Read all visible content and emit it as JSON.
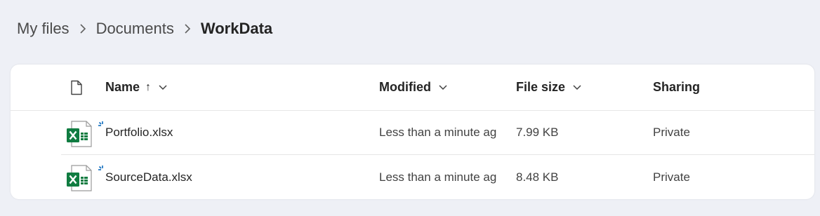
{
  "breadcrumb": {
    "items": [
      "My files",
      "Documents"
    ],
    "current": "WorkData"
  },
  "table": {
    "headers": {
      "name": "Name",
      "sort_arrow": "↑",
      "modified": "Modified",
      "file_size": "File size",
      "sharing": "Sharing"
    },
    "rows": [
      {
        "name": "Portfolio.xlsx",
        "modified": "Less than a minute ag",
        "file_size": "7.99 KB",
        "sharing": "Private",
        "icon": "excel-file-icon"
      },
      {
        "name": "SourceData.xlsx",
        "modified": "Less than a minute ag",
        "file_size": "8.48 KB",
        "sharing": "Private",
        "icon": "excel-file-icon"
      }
    ]
  },
  "colors": {
    "excel_green": "#107c41",
    "new_badge_blue": "#0f6cbd",
    "background": "#eef0f6"
  }
}
